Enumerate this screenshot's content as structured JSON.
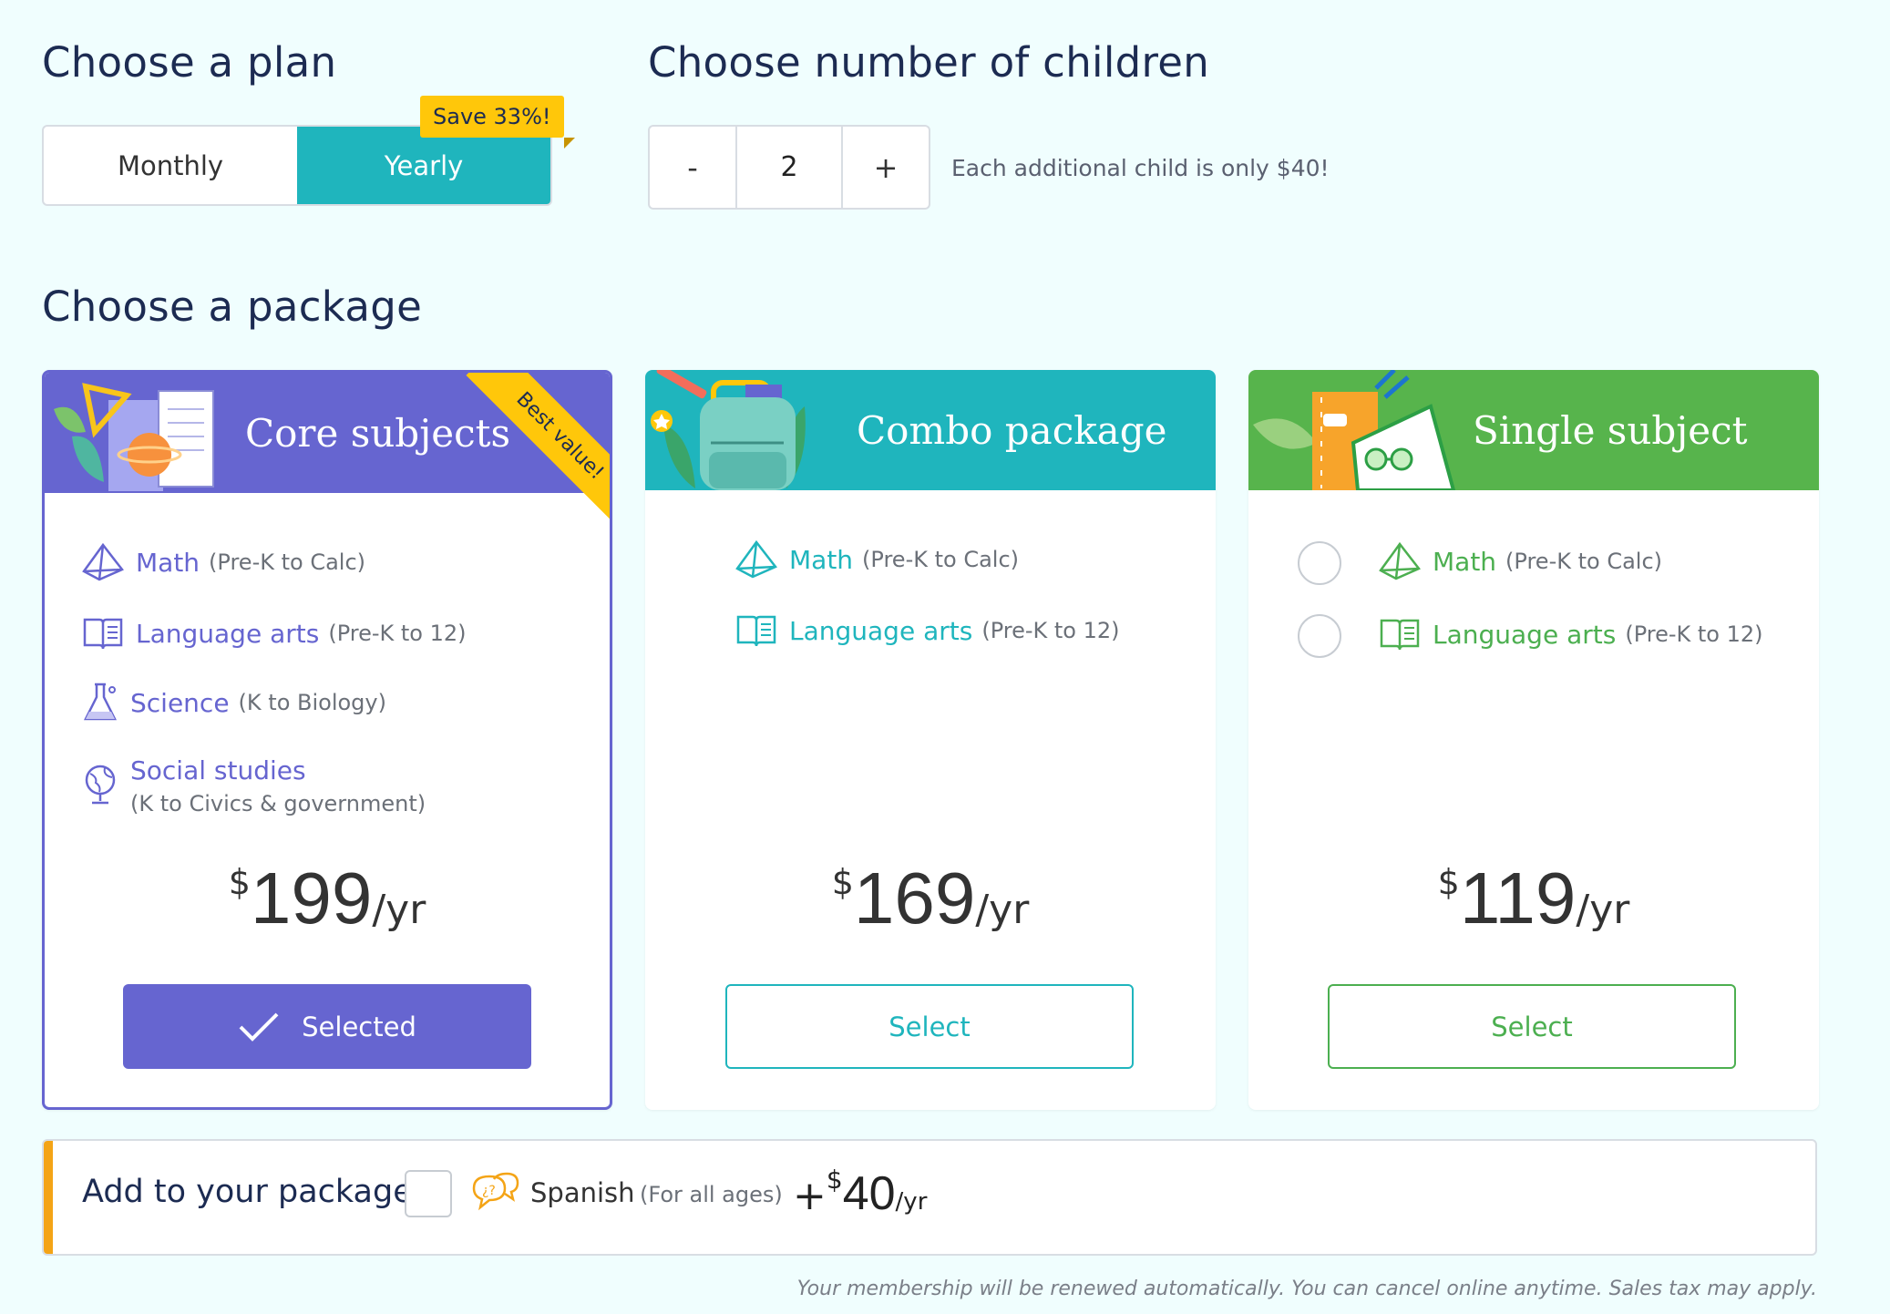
{
  "plan": {
    "heading": "Choose a plan",
    "options": [
      "Monthly",
      "Yearly"
    ],
    "selected": "Yearly",
    "save_badge": "Save 33%!"
  },
  "children": {
    "heading": "Choose number of children",
    "minus_label": "-",
    "value": "2",
    "plus_label": "+",
    "note": "Each additional child is only $40!"
  },
  "package": {
    "heading": "Choose a package",
    "cards": [
      {
        "title": "Core subjects",
        "ribbon": "Best value!",
        "header_color": "#6665d0",
        "accent": "#6665d0",
        "subjects": [
          {
            "name": "Math",
            "range": "(Pre-K to Calc)",
            "icon": "pyramid-icon"
          },
          {
            "name": "Language arts",
            "range": "(Pre-K to 12)",
            "icon": "book-icon"
          },
          {
            "name": "Science",
            "range": "(K to Biology)",
            "icon": "flask-icon"
          },
          {
            "name": "Social studies",
            "range": "(K to Civics & government)",
            "icon": "globe-icon"
          }
        ],
        "currency": "$",
        "price": "199",
        "period": "/yr",
        "button": "Selected",
        "selected": true
      },
      {
        "title": "Combo package",
        "header_color": "#1fb5bd",
        "accent": "#1fb5bd",
        "subjects": [
          {
            "name": "Math",
            "range": "(Pre-K to Calc)",
            "icon": "pyramid-icon"
          },
          {
            "name": "Language arts",
            "range": "(Pre-K to 12)",
            "icon": "book-icon"
          }
        ],
        "currency": "$",
        "price": "169",
        "period": "/yr",
        "button": "Select",
        "selected": false
      },
      {
        "title": "Single subject",
        "header_color": "#57b44c",
        "accent": "#4caf50",
        "subjects": [
          {
            "name": "Math",
            "range": "(Pre-K to Calc)",
            "icon": "pyramid-icon"
          },
          {
            "name": "Language arts",
            "range": "(Pre-K to 12)",
            "icon": "book-icon"
          }
        ],
        "currency": "$",
        "price": "119",
        "period": "/yr",
        "button": "Select",
        "selected": false
      }
    ]
  },
  "addon": {
    "label": "Add to your package",
    "name": "Spanish",
    "range": "(For all ages)",
    "plus": "+",
    "currency": "$",
    "price": "40",
    "period": "/yr",
    "accent": "#f4a416",
    "checked": false
  },
  "footnote": "Your membership will be renewed automatically. You can cancel online anytime. Sales tax may apply."
}
